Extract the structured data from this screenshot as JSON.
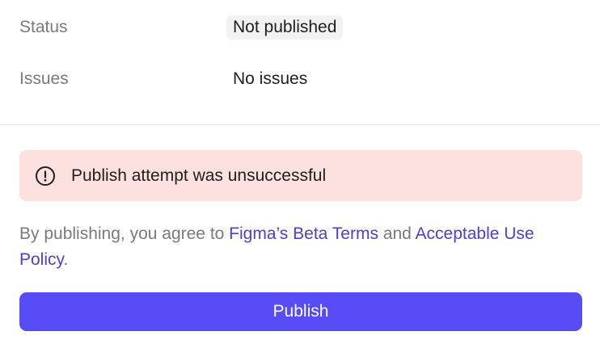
{
  "details": {
    "status_label": "Status",
    "status_value": "Not published",
    "issues_label": "Issues",
    "issues_value": "No issues"
  },
  "error": {
    "icon": "alert-circle-icon",
    "message": "Publish attempt was unsuccessful"
  },
  "terms": {
    "prefix": "By publishing, you agree to ",
    "link1": "Figma’s Beta Terms",
    "middle": " and ",
    "link2": "Acceptable Use Policy",
    "suffix": "."
  },
  "actions": {
    "publish_label": "Publish"
  },
  "colors": {
    "accent": "#574cf5",
    "link": "#4b3fd6",
    "error_bg": "#fde1df",
    "muted_text": "#7a7a7a"
  }
}
